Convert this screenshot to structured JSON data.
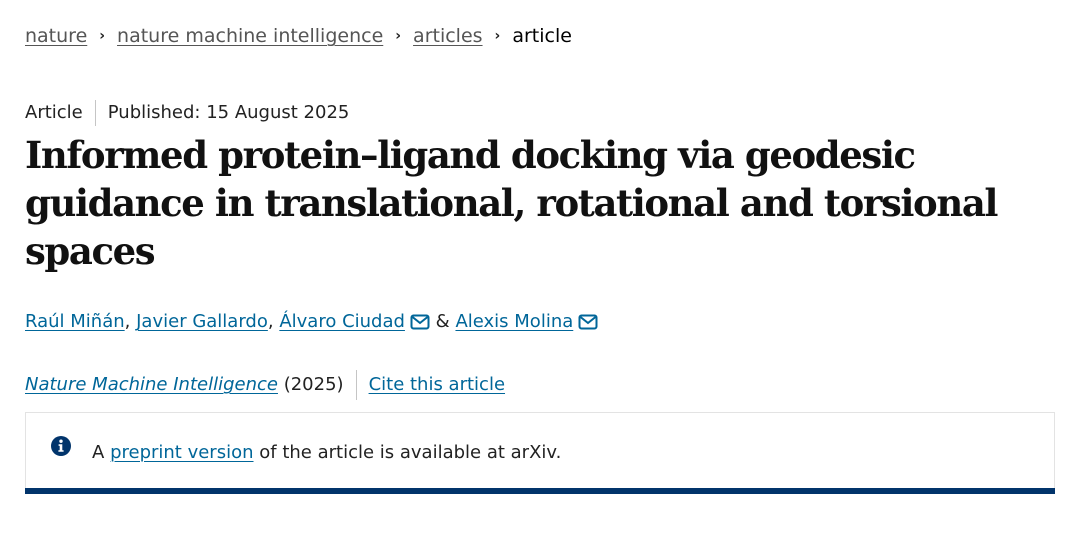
{
  "breadcrumb": {
    "items": [
      "nature",
      "nature machine intelligence",
      "articles"
    ],
    "current": "article",
    "separator": "›"
  },
  "meta": {
    "type": "Article",
    "published": "Published: 15 August 2025"
  },
  "title": "Informed protein–ligand docking via geodesic guidance in translational, rotational and torsional spaces",
  "authors": [
    {
      "name": "Raúl Miñán",
      "suffix": ","
    },
    {
      "name": "Javier Gallardo",
      "suffix": ","
    },
    {
      "name": "Álvaro Ciudad",
      "suffix": ""
    },
    {
      "name": "Alexis Molina",
      "suffix": ""
    }
  ],
  "authors_joiner": "&",
  "citation": {
    "journal": "Nature Machine Intelligence",
    "year": "(2025)",
    "cite_link": "Cite this article"
  },
  "notice": {
    "prefix": "A",
    "link": "preprint version",
    "suffix": "of the article is available at arXiv."
  },
  "icons": {
    "mail": "mail-icon",
    "info": "info-icon"
  },
  "colors": {
    "link": "#006699",
    "notice_bar": "#01346b",
    "text": "#222222"
  }
}
